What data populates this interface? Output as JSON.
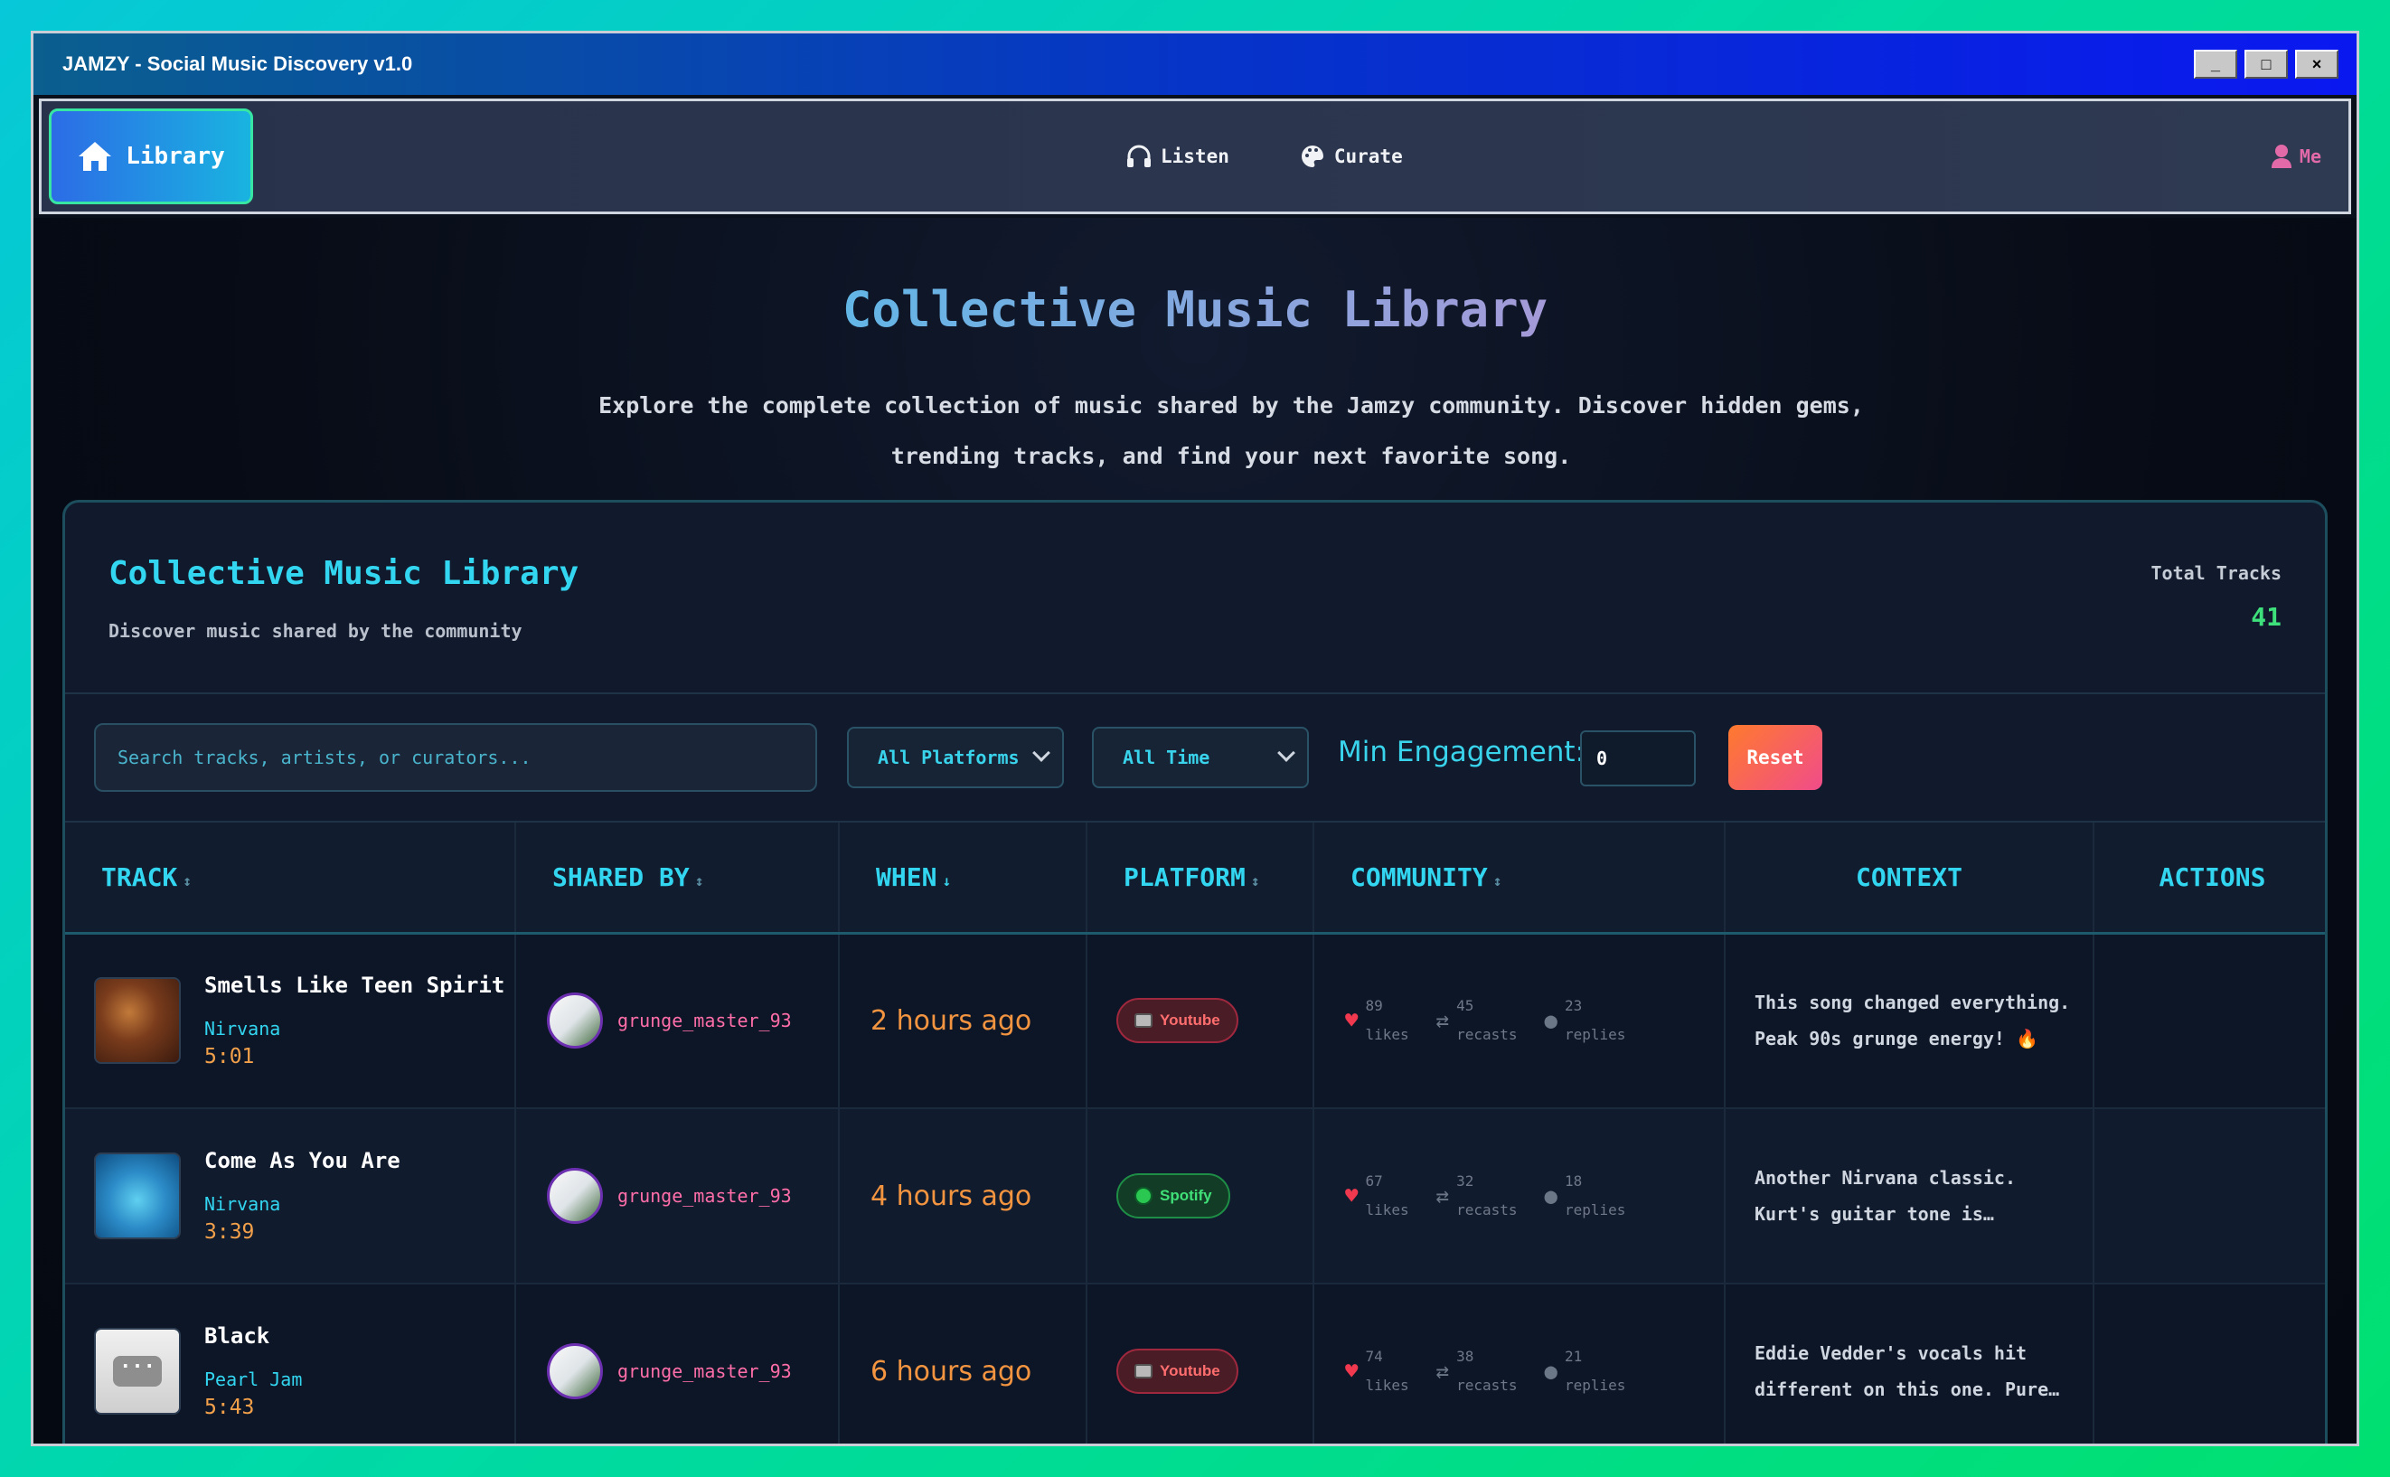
{
  "window": {
    "title": "JAMZY - Social Music Discovery v1.0",
    "controls": [
      "_",
      "□",
      "×"
    ]
  },
  "nav": {
    "library": "Library",
    "listen": "Listen",
    "curate": "Curate",
    "me": "Me",
    "icons": {
      "library": "home-icon",
      "listen": "headphones-icon",
      "curate": "palette-icon",
      "me": "user-icon"
    }
  },
  "hero": {
    "title": "Collective Music Library",
    "description": "Explore the complete collection of music shared by the Jamzy community. Discover hidden gems, trending tracks, and find your next favorite song."
  },
  "panel": {
    "title": "Collective Music Library",
    "subtitle": "Discover music shared by the community",
    "total_label": "Total Tracks",
    "total_value": "41"
  },
  "filters": {
    "search_placeholder": "Search tracks, artists, or curators...",
    "platform": "All Platforms",
    "time": "All Time",
    "min_label": "Min Engagement:",
    "min_value": "0",
    "reset": "Reset"
  },
  "table": {
    "headers": {
      "track": "TRACK",
      "shared_by": "SHARED BY",
      "when": "WHEN",
      "platform": "PLATFORM",
      "community": "COMMUNITY",
      "context": "CONTEXT",
      "actions": "ACTIONS"
    },
    "sort_icons": {
      "inactive": "↕",
      "active": "↓"
    },
    "rows": [
      {
        "title": "Smells Like Teen Spirit",
        "artist": "Nirvana",
        "duration": "5:01",
        "user": "grunge_master_93",
        "when": "2 hours ago",
        "platform": "Youtube",
        "likes": "89",
        "likes_label": "likes",
        "recasts": "45",
        "recasts_label": "recasts",
        "replies": "23",
        "replies_label": "replies",
        "context": "This song changed everything. Peak 90s grunge energy! 🔥"
      },
      {
        "title": "Come As You Are",
        "artist": "Nirvana",
        "duration": "3:39",
        "user": "grunge_master_93",
        "when": "4 hours ago",
        "platform": "Spotify",
        "likes": "67",
        "likes_label": "likes",
        "recasts": "32",
        "recasts_label": "recasts",
        "replies": "18",
        "replies_label": "replies",
        "context": "Another Nirvana classic. Kurt's guitar tone is…"
      },
      {
        "title": "Black",
        "artist": "Pearl Jam",
        "duration": "5:43",
        "user": "grunge_master_93",
        "when": "6 hours ago",
        "platform": "Youtube",
        "likes": "74",
        "likes_label": "likes",
        "recasts": "38",
        "recasts_label": "recasts",
        "replies": "21",
        "replies_label": "replies",
        "context": "Eddie Vedder's vocals hit different on this one. Pure…"
      }
    ]
  }
}
